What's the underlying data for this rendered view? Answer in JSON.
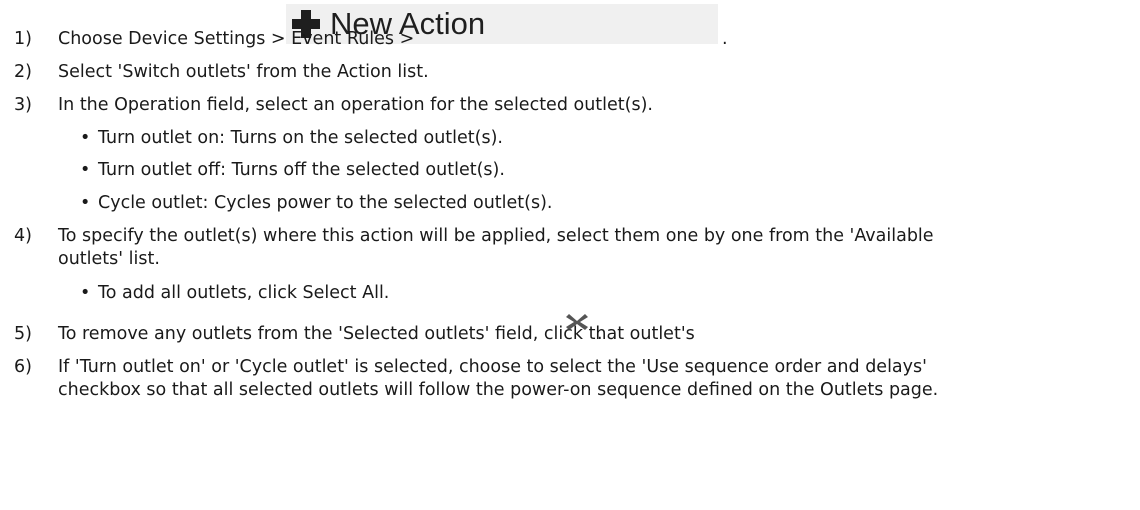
{
  "steps": [
    {
      "num": "1)",
      "text": "Choose Device Settings > Event Rules >",
      "tail": "."
    },
    {
      "num": "2)",
      "text": "Select 'Switch outlets' from the Action list."
    },
    {
      "num": "3)",
      "text": "In the Operation field, select an operation for the selected outlet(s)."
    },
    {
      "num": "4)",
      "line1": "To specify the outlet(s) where this action will be applied, select them one by one from the 'Available",
      "line2": "outlets' list."
    },
    {
      "num": "5)",
      "text": "To remove any outlets from the 'Selected outlets' field, click that outlet's",
      "tail": "."
    },
    {
      "num": "6)",
      "line1": "If 'Turn outlet on' or 'Cycle outlet' is selected, choose to select the 'Use sequence order and delays'",
      "line2": "checkbox so that all selected outlets will follow the power-on sequence defined on the Outlets page."
    }
  ],
  "step3_bullets": [
    "Turn outlet on: Turns on the selected outlet(s).",
    "Turn outlet off: Turns off the selected outlet(s).",
    "Cycle outlet: Cycles power to the selected outlet(s)."
  ],
  "step4_bullets": [
    "To add all outlets, click Select All."
  ],
  "bullet_glyph": "•",
  "new_action_button": {
    "label": "New Action",
    "icon": "plus-icon"
  },
  "remove_icon": "close-x-icon"
}
